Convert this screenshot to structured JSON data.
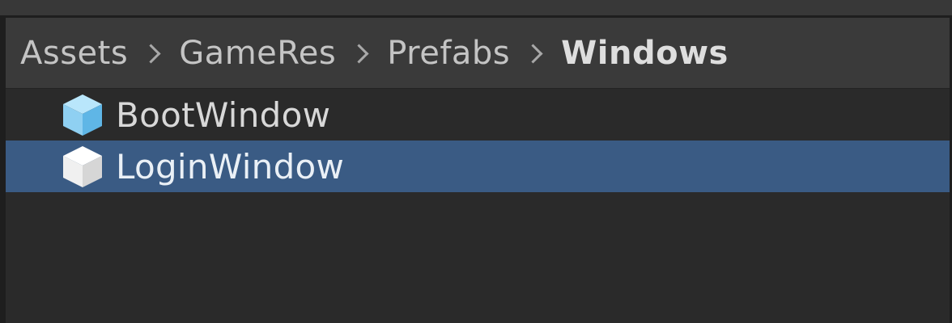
{
  "breadcrumb": {
    "items": [
      "Assets",
      "GameRes",
      "Prefabs",
      "Windows"
    ]
  },
  "files": [
    {
      "name": "BootWindow",
      "icon": "prefab-cube-icon",
      "selected": false,
      "icon_color": "#8fd0f2"
    },
    {
      "name": "LoginWindow",
      "icon": "prefab-cube-icon",
      "selected": true,
      "icon_color": "#f2f2f2"
    }
  ],
  "colors": {
    "selection": "#3a5b84",
    "panel": "#2a2a2a",
    "breadcrumb_bar": "#3a3a3a"
  }
}
